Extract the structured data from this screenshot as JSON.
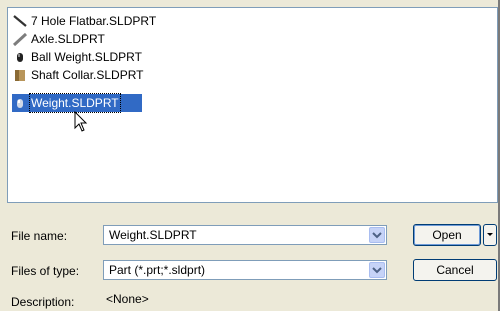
{
  "files": [
    {
      "name": "7 Hole Flatbar.SLDPRT",
      "icon": "flatbar-part-icon",
      "selected": false
    },
    {
      "name": "Axle.SLDPRT",
      "icon": "axle-part-icon",
      "selected": false
    },
    {
      "name": "Ball Weight.SLDPRT",
      "icon": "ball-weight-part-icon",
      "selected": false
    },
    {
      "name": "Shaft Collar.SLDPRT",
      "icon": "shaft-collar-part-icon",
      "selected": false
    },
    {
      "name": "Weight.SLDPRT",
      "icon": "weight-part-icon",
      "selected": true
    }
  ],
  "form": {
    "file_name_label": "File name:",
    "file_name_value": "Weight.SLDPRT",
    "files_of_type_label": "Files of type:",
    "files_of_type_value": "Part (*.prt;*.sldprt)",
    "description_label": "Description:",
    "description_value": "<None>"
  },
  "buttons": {
    "open_label": "Open",
    "cancel_label": "Cancel"
  },
  "colors": {
    "selection": "#316ac5",
    "dialog_bg": "#ece9d8",
    "border": "#7f9db9"
  }
}
